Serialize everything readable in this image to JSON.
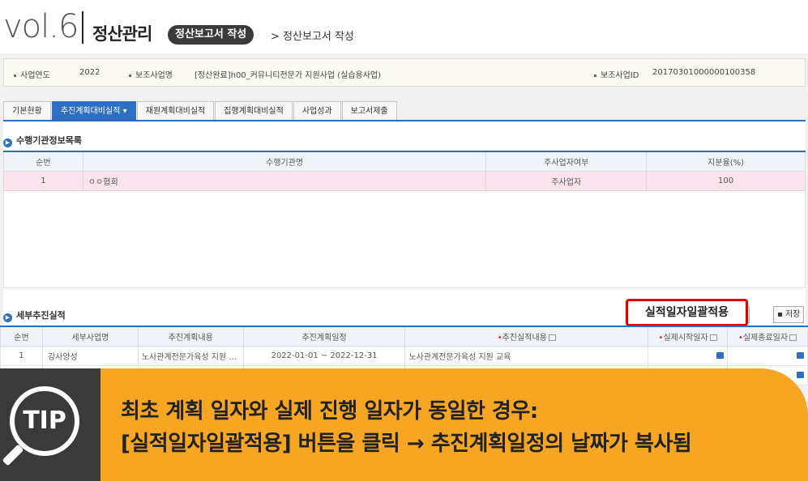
{
  "header": {
    "vol": "vol.6",
    "section": "정산관리",
    "pill": "정산보고서 작성",
    "crumb": "> 정산보고서 작성"
  },
  "info": {
    "year_label": "사업연도",
    "year_value": "2022",
    "project_label": "보조사업명",
    "project_value": "[정산완료]h00_커뮤니티전문가 지원사업 (실습용사업)",
    "id_label": "보조사업ID",
    "id_value": "20170301000000100358"
  },
  "tabs": [
    {
      "label": "기본현황"
    },
    {
      "label": "추진계획대비실적 ▾"
    },
    {
      "label": "재원계획대비실적"
    },
    {
      "label": "집행계획대비실적"
    },
    {
      "label": "사업성과"
    },
    {
      "label": "보고서제출"
    }
  ],
  "section1": {
    "title": "수행기관정보목록",
    "columns": [
      "순번",
      "수행기관명",
      "주사업자여부",
      "지분율(%)"
    ],
    "rows": [
      {
        "no": "1",
        "name": "ㅇㅇ협회",
        "main": "주사업자",
        "share": "100"
      }
    ]
  },
  "section2": {
    "title": "세부추진실적",
    "highlight_button": "실적일자일괄적용",
    "partial_button": "용",
    "save_button": "저장",
    "columns": [
      "순번",
      "세부사업명",
      "추진계획내용",
      "추진계획일정",
      "추진실적내용",
      "실제시작일자",
      "실제종료일자"
    ],
    "rows": [
      {
        "no": "1",
        "name": "강사양성",
        "plan": "노사관계전문가육성 지원 …",
        "schedule": "2022-01-01 ~ 2022-12-31",
        "result": "노사관계전문가육성 지원 교육"
      }
    ]
  },
  "tip": {
    "badge": "TIP",
    "line1": "최초 계획 일자와 실제 진행 일자가 동일한 경우:",
    "line2": "[실적일자일괄적용] 버튼을 클릭 → 추진계획일정의 날짜가 복사됨"
  },
  "colors": {
    "accent": "#2d6fc3",
    "tip_yellow": "#f6a623",
    "tip_dark": "#3a3a3a",
    "highlight_border": "#e00000",
    "row_pink": "#fbe4ee"
  }
}
